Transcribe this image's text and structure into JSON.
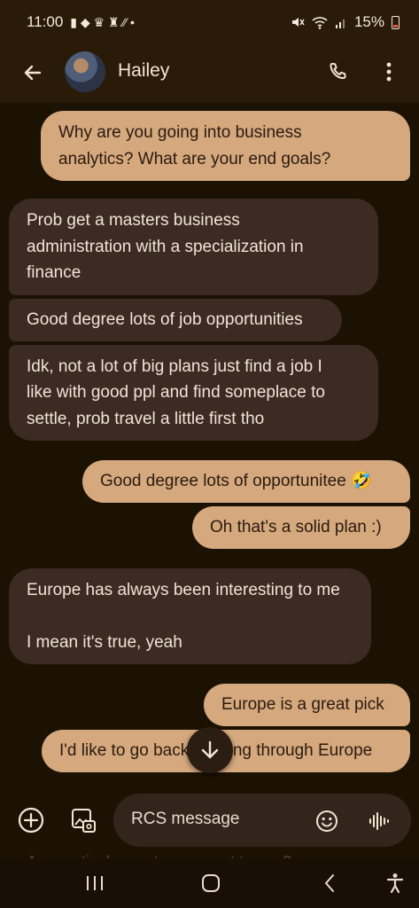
{
  "status_bar": {
    "time": "11:00",
    "notif_icons": "▮ ◆ ♛ ♜ ⁄⁄ •",
    "battery": "15%"
  },
  "header": {
    "contact_name": "Hailey"
  },
  "messages": [
    {
      "direction": "outgoing",
      "text": "Why are you going into business\nanalytics? What are your end goals?"
    },
    {
      "direction": "incoming",
      "text": "Prob get a masters business\nadministration with a specialization in\nfinance"
    },
    {
      "direction": "incoming",
      "text": "Good degree lots of job opportunities"
    },
    {
      "direction": "incoming",
      "text": "Idk, not a lot of big plans just find a job I\nlike with good ppl and find someplace to\nsettle, prob travel a little first tho"
    },
    {
      "direction": "outgoing",
      "text": "Good degree lots of opportunitee 🤣"
    },
    {
      "direction": "outgoing",
      "text": "Oh that's a solid plan :)"
    },
    {
      "direction": "incoming",
      "text": "Europe has always been interesting to me\n\nI mean it's true, yeah"
    },
    {
      "direction": "outgoing",
      "text": "Europe is a great pick"
    },
    {
      "direction": "outgoing",
      "text": "I'd like to go back packing through Europe"
    }
  ],
  "composer": {
    "placeholder": "RCS message",
    "ghost_text": "Any particular spots you want to see?"
  },
  "colors": {
    "outgoing_bubble": "#d5a87d",
    "incoming_bubble": "#3b2b22",
    "background": "#1c1204",
    "header": "#2a1b08"
  },
  "icons": {
    "back": "arrow-left-icon",
    "call": "phone-icon",
    "more": "more-vert-icon",
    "scroll": "arrow-down-icon",
    "add": "add-circle-icon",
    "gallery": "gallery-icon",
    "emoji": "emoji-icon",
    "voice": "voice-wave-icon",
    "nav_recents": "recents-icon",
    "nav_home": "home-icon",
    "nav_back": "nav-back-icon",
    "nav_accessibility": "accessibility-icon"
  }
}
